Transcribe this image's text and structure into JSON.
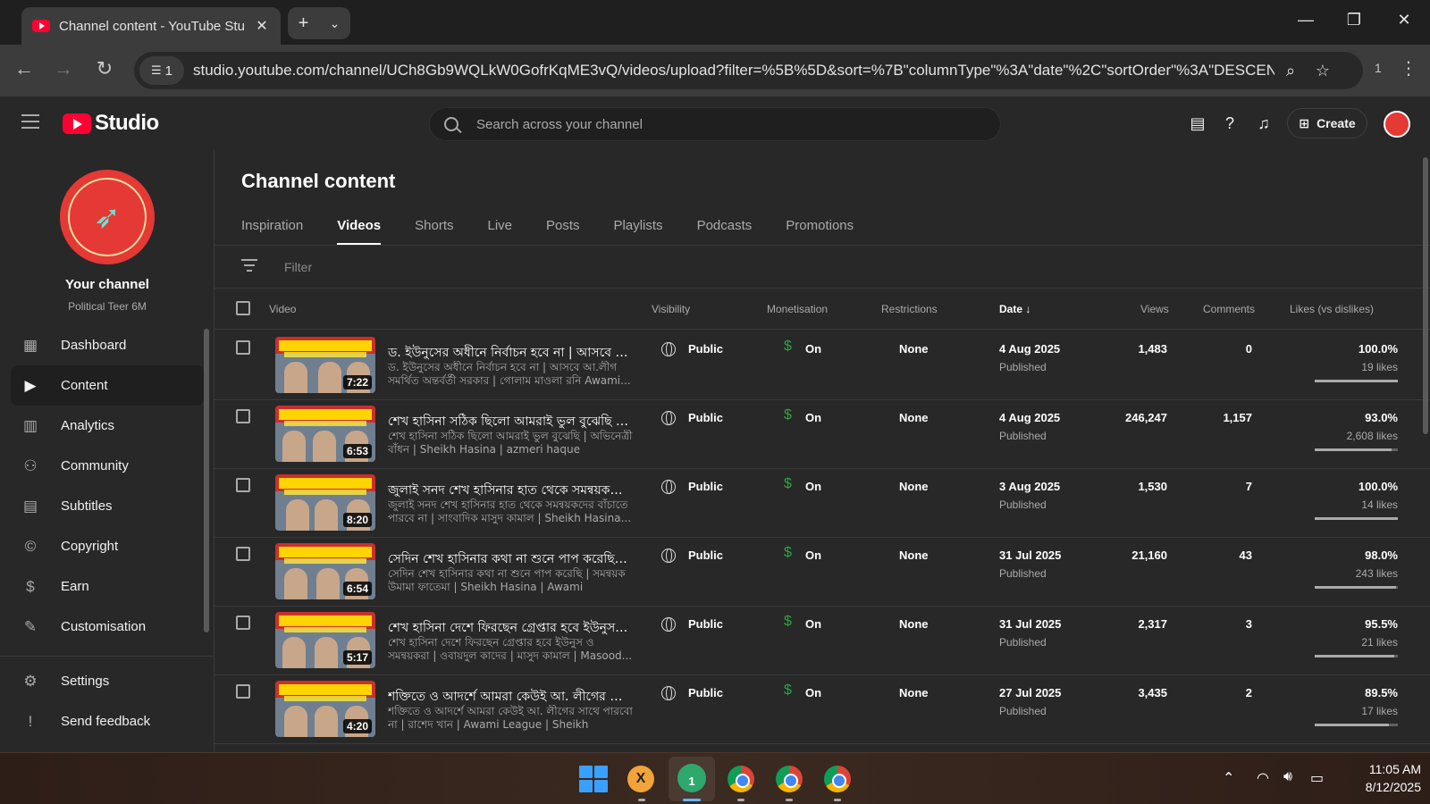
{
  "browser": {
    "tab_title": "Channel content - YouTube Studio",
    "url": "studio.youtube.com/channel/UCh8Gb9WQLkW0GofrKqME3vQ/videos/upload?filter=%5B%5D&sort=%7B\"columnType\"%3A\"date\"%2C\"sortOrder\"%3A\"DESCENDING\"%7D",
    "site_info_count": "1",
    "extensions_count": "1"
  },
  "header": {
    "logo_text": "Studio",
    "search_placeholder": "Search across your channel",
    "create_label": "Create"
  },
  "sidebar": {
    "your_channel": "Your channel",
    "channel_name": "Political Teer 6M",
    "items": [
      {
        "label": "Dashboard",
        "icon": "dashboard-icon",
        "glyph": "▦"
      },
      {
        "label": "Content",
        "icon": "content-icon",
        "glyph": "▶",
        "active": true
      },
      {
        "label": "Analytics",
        "icon": "analytics-icon",
        "glyph": "▥"
      },
      {
        "label": "Community",
        "icon": "community-icon",
        "glyph": "⚇"
      },
      {
        "label": "Subtitles",
        "icon": "subtitles-icon",
        "glyph": "▤"
      },
      {
        "label": "Copyright",
        "icon": "copyright-icon",
        "glyph": "©"
      },
      {
        "label": "Earn",
        "icon": "earn-icon",
        "glyph": "$"
      },
      {
        "label": "Customisation",
        "icon": "customisation-icon",
        "glyph": "✎"
      }
    ],
    "bottom_items": [
      {
        "label": "Settings",
        "icon": "settings-icon",
        "glyph": "⚙"
      },
      {
        "label": "Send feedback",
        "icon": "feedback-icon",
        "glyph": "!"
      }
    ]
  },
  "main": {
    "title": "Channel content",
    "tabs": [
      "Inspiration",
      "Videos",
      "Shorts",
      "Live",
      "Posts",
      "Playlists",
      "Podcasts",
      "Promotions"
    ],
    "active_tab": "Videos",
    "filter_placeholder": "Filter",
    "columns": {
      "video": "Video",
      "visibility": "Visibility",
      "monetisation": "Monetisation",
      "restrictions": "Restrictions",
      "date": "Date ↓",
      "views": "Views",
      "comments": "Comments",
      "likes": "Likes (vs dislikes)"
    },
    "rows": [
      {
        "title": "ড. ইউনুসের অধীনে নির্বাচন হবে না | আসবে আ.লীগ সমর্থিত অন্তর্বর্তী সরকার",
        "desc": "ড. ইউনুসের অধীনে নির্বাচন হবে না | আসবে আ.লীগ সমর্থিত অন্তর্বর্তী সরকার | গোলাম মাওলা রনি Awami...",
        "duration": "7:22",
        "visibility": "Public",
        "monetisation": "On",
        "restrictions": "None",
        "date": "4 Aug 2025",
        "status": "Published",
        "views": "1,483",
        "comments": "0",
        "likes_pct": "100.0%",
        "likes": "19 likes",
        "like_ratio": 1.0
      },
      {
        "title": "শেখ হাসিনা সঠিক ছিলো আমরাই ভুল বুঝেছি | অভিনেত্রী বাঁধন",
        "desc": "শেখ হাসিনা সঠিক ছিলো আমরাই ভুল বুঝেছি | অভিনেত্রী বাঁধন | Sheikh Hasina | azmeri haque badhon...",
        "duration": "6:53",
        "visibility": "Public",
        "monetisation": "On",
        "restrictions": "None",
        "date": "4 Aug 2025",
        "status": "Published",
        "views": "246,247",
        "comments": "1,157",
        "likes_pct": "93.0%",
        "likes": "2,608 likes",
        "like_ratio": 0.93
      },
      {
        "title": "জুলাই সনদ শেখ হাসিনার হাত থেকে সমন্বয়কদের বাঁচাতে পারবে না",
        "desc": "জুলাই সনদ শেখ হাসিনার হাত থেকে সমন্বয়কদের বাঁচাতে পারবে না | সাংবাদিক মাসুদ কামাল | Sheikh Hasina...",
        "duration": "8:20",
        "visibility": "Public",
        "monetisation": "On",
        "restrictions": "None",
        "date": "3 Aug 2025",
        "status": "Published",
        "views": "1,530",
        "comments": "7",
        "likes_pct": "100.0%",
        "likes": "14 likes",
        "like_ratio": 1.0
      },
      {
        "title": "সেদিন শেখ হাসিনার কথা না শুনে পাপ করেছি | সমন্বয়ক উমামা ফাতেমা",
        "desc": "সেদিন শেখ হাসিনার কথা না শুনে পাপ করেছি | সমন্বয়ক উমামা ফাতেমা | Sheikh Hasina | Awami League...",
        "duration": "6:54",
        "visibility": "Public",
        "monetisation": "On",
        "restrictions": "None",
        "date": "31 Jul 2025",
        "status": "Published",
        "views": "21,160",
        "comments": "43",
        "likes_pct": "98.0%",
        "likes": "243 likes",
        "like_ratio": 0.98
      },
      {
        "title": "শেখ হাসিনা দেশে ফিরছেন গ্রেপ্তার হবে ইউনুস ও সমন্বয়করা",
        "desc": "শেখ হাসিনা দেশে ফিরছেন গ্রেপ্তার হবে ইউনুস ও সমন্বয়করা | ওবায়দুল কাদের | মাসুদ কামাল | Masood...",
        "duration": "5:17",
        "visibility": "Public",
        "monetisation": "On",
        "restrictions": "None",
        "date": "31 Jul 2025",
        "status": "Published",
        "views": "2,317",
        "comments": "3",
        "likes_pct": "95.5%",
        "likes": "21 likes",
        "like_ratio": 0.955
      },
      {
        "title": "শক্তিতে ও আদর্শে আমরা কেউই আ. লীগের সাথে পারবো না",
        "desc": "শক্তিতে ও আদর্শে আমরা কেউই আ. লীগের সাথে পারবো না | রাশেদ খান | Awami League | Sheikh Hasina...",
        "duration": "4:20",
        "visibility": "Public",
        "monetisation": "On",
        "restrictions": "None",
        "date": "27 Jul 2025",
        "status": "Published",
        "views": "3,435",
        "comments": "2",
        "likes_pct": "89.5%",
        "likes": "17 likes",
        "like_ratio": 0.895
      }
    ]
  },
  "taskbar": {
    "time": "11:05 AM",
    "date": "8/12/2025",
    "badge": "1"
  }
}
